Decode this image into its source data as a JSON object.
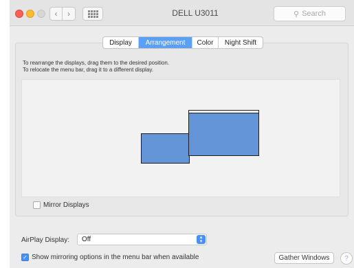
{
  "window": {
    "title": "DELL U3011",
    "search_placeholder": "Search"
  },
  "toolbar": {
    "back_icon": "chevron-left-icon",
    "forward_icon": "chevron-right-icon",
    "grid_icon": "grid-icon",
    "back_glyph": "‹",
    "forward_glyph": "›",
    "search_glyph": "⚲"
  },
  "tabs": [
    {
      "label": "Display",
      "active": false
    },
    {
      "label": "Arrangement",
      "active": true
    },
    {
      "label": "Color",
      "active": false
    },
    {
      "label": "Night Shift",
      "active": false
    }
  ],
  "arrangement": {
    "instruction_1": "To rearrange the displays, drag them to the desired position.",
    "instruction_2": "To relocate the menu bar, drag it to a different display.",
    "display_color": "#6494d8"
  },
  "mirror_displays": {
    "label": "Mirror Displays",
    "checked": false
  },
  "airplay": {
    "label": "AirPlay Display:",
    "value": "Off"
  },
  "show_mirroring": {
    "label": "Show mirroring options in the menu bar when available",
    "checked": true,
    "check_glyph": "✓"
  },
  "buttons": {
    "gather_windows": "Gather Windows",
    "help": "?"
  },
  "colors": {
    "accent": "#4a8ff3",
    "tab_active": "#5b9ff6",
    "close": "#fc5f57",
    "minimize": "#fdbc2e"
  }
}
